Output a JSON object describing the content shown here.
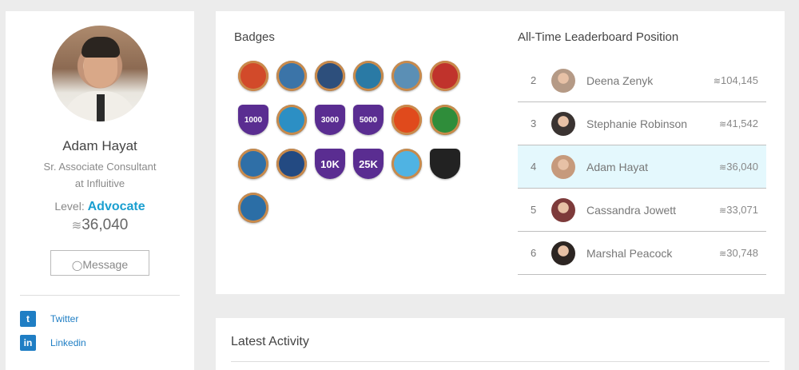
{
  "profile": {
    "name": "Adam Hayat",
    "title_line1": "Sr. Associate Consultant",
    "title_line2": "at Influitive",
    "level_label": "Level:",
    "level_value": "Advocate",
    "points": "36,040",
    "message_label": "Message",
    "social": [
      {
        "icon": "twitter-icon",
        "glyph": "t",
        "label": "Twitter"
      },
      {
        "icon": "linkedin-icon",
        "glyph": "in",
        "label": "Linkedin"
      }
    ]
  },
  "badges_title": "Badges",
  "badges": [
    {
      "icon": "pen-badge-icon",
      "text": "",
      "color": "#d24a2a",
      "shape": "round"
    },
    {
      "icon": "bottle-badge-icon",
      "text": "",
      "color": "#3b74a8",
      "shape": "round"
    },
    {
      "icon": "trophy-wreath-badge-icon",
      "text": "",
      "color": "#2d4f7c",
      "shape": "round"
    },
    {
      "icon": "medal-badge-icon",
      "text": "",
      "color": "#2a7aa5",
      "shape": "round"
    },
    {
      "icon": "trophy-badge-icon",
      "text": "",
      "color": "#5b8fb5",
      "shape": "round"
    },
    {
      "icon": "people-badge-icon",
      "text": "",
      "color": "#c0332c",
      "shape": "round"
    },
    {
      "icon": "1000-badge-icon",
      "text": "1000",
      "color": "#5a2d91",
      "shape": "shield"
    },
    {
      "icon": "ring-badge-icon",
      "text": "",
      "color": "#2c8fc4",
      "shape": "round"
    },
    {
      "icon": "3000-badge-icon",
      "text": "3000",
      "color": "#5a2d91",
      "shape": "shield"
    },
    {
      "icon": "5000-badge-icon",
      "text": "5000",
      "color": "#5a2d91",
      "shape": "shield"
    },
    {
      "icon": "building-badge-icon",
      "text": "",
      "color": "#e04a1c",
      "shape": "round"
    },
    {
      "icon": "tree-badge-icon",
      "text": "",
      "color": "#2f8d3a",
      "shape": "round"
    },
    {
      "icon": "cake-badge-icon",
      "text": "",
      "color": "#2f6fa7",
      "shape": "round"
    },
    {
      "icon": "graduate-badge-icon",
      "text": "",
      "color": "#234a82",
      "shape": "round"
    },
    {
      "icon": "10k-badge-icon",
      "text": "10K",
      "color": "#5a2d91",
      "shape": "shield"
    },
    {
      "icon": "25k-badge-icon",
      "text": "25K",
      "color": "#5a2d91",
      "shape": "shield"
    },
    {
      "icon": "gold-trophy-badge-icon",
      "text": "",
      "color": "#4fb3e3",
      "shape": "round"
    },
    {
      "icon": "dice-badge-icon",
      "text": "",
      "color": "#222222",
      "shape": "shield"
    },
    {
      "icon": "trophy-gold-badge-icon",
      "text": "",
      "color": "#2b6ea6",
      "shape": "round"
    }
  ],
  "leaderboard_title": "All-Time Leaderboard Position",
  "leaderboard": [
    {
      "rank": "2",
      "name": "Deena Zenyk",
      "points": "104,145",
      "avatar": "#b59a86",
      "me": false
    },
    {
      "rank": "3",
      "name": "Stephanie Robinson",
      "points": "41,542",
      "avatar": "#3a3331",
      "me": false
    },
    {
      "rank": "4",
      "name": "Adam Hayat",
      "points": "36,040",
      "avatar": "#c69a7c",
      "me": true
    },
    {
      "rank": "5",
      "name": "Cassandra Jowett",
      "points": "33,071",
      "avatar": "#7d3a3a",
      "me": false
    },
    {
      "rank": "6",
      "name": "Marshal Peacock",
      "points": "30,748",
      "avatar": "#2c2522",
      "me": false
    }
  ],
  "activity_title": "Latest Activity"
}
